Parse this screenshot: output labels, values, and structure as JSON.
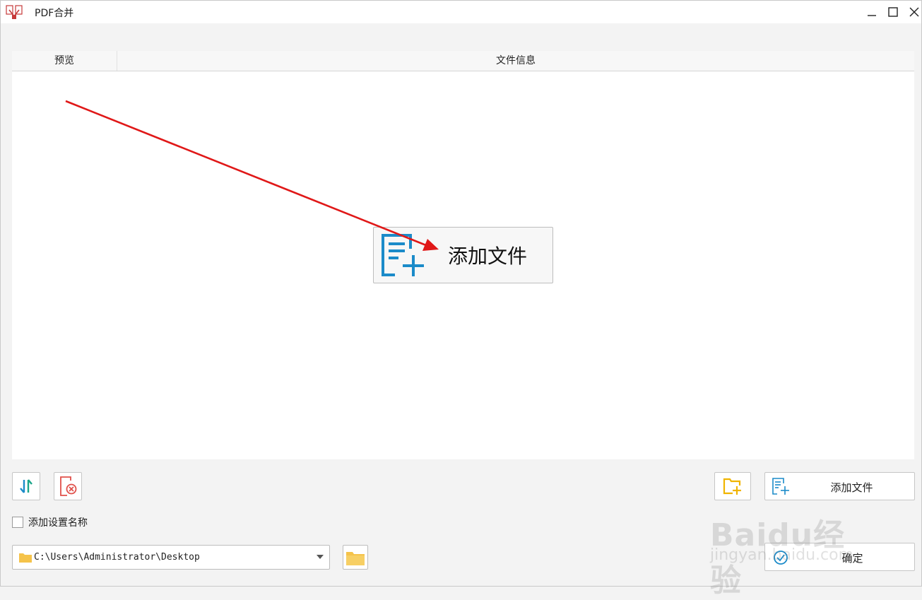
{
  "window": {
    "title": "PDF合并"
  },
  "list": {
    "columns": [
      "预览",
      "文件信息"
    ],
    "center_add_label": "添加文件"
  },
  "toolbar": {
    "add_file_label": "添加文件",
    "confirm_label": "确定"
  },
  "options": {
    "add_settings_name_label": "添加设置名称",
    "add_settings_name_checked": false
  },
  "output": {
    "path": "C:\\Users\\Administrator\\Desktop"
  },
  "colors": {
    "accent_blue": "#1b8bc9",
    "annotation_red": "#e01818",
    "folder_yellow": "#f0b400",
    "delete_red": "#e0504a"
  },
  "icons": [
    "app-icon",
    "minimize-icon",
    "maximize-icon",
    "close-icon",
    "add-file-icon",
    "sort-icon",
    "delete-file-icon",
    "add-folder-icon",
    "folder-icon",
    "chevron-down-icon",
    "confirm-icon"
  ],
  "watermark": {
    "main": "Baidu经验",
    "sub": "jingyan.baidu.com"
  }
}
